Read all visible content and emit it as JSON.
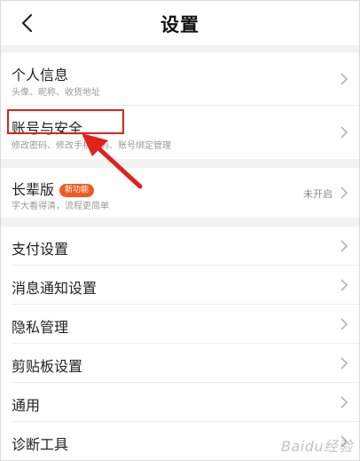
{
  "header": {
    "title": "设置",
    "back_icon": "chevron-left-icon"
  },
  "groups": [
    {
      "items": [
        {
          "title": "个人信息",
          "subtitle": "头像、昵称、收货地址"
        },
        {
          "title": "账号与安全",
          "subtitle": "修改密码、修改手机号码、账号绑定管理"
        }
      ]
    },
    {
      "items": [
        {
          "title": "长辈版",
          "badge": "新功能",
          "subtitle": "字大看得清，流程更简单",
          "status": "未开启"
        }
      ]
    },
    {
      "items": [
        {
          "title": "支付设置"
        },
        {
          "title": "消息通知设置"
        },
        {
          "title": "隐私管理"
        },
        {
          "title": "剪贴板设置"
        },
        {
          "title": "通用"
        },
        {
          "title": "诊断工具"
        }
      ]
    }
  ],
  "annotation": {
    "highlight_color": "#e0221b",
    "highlighted_item": "账号与安全"
  },
  "watermark": "Baidu经验",
  "colors": {
    "badge": "#f05a22",
    "page_background": "#f2f2f2",
    "card_background": "#ffffff"
  }
}
